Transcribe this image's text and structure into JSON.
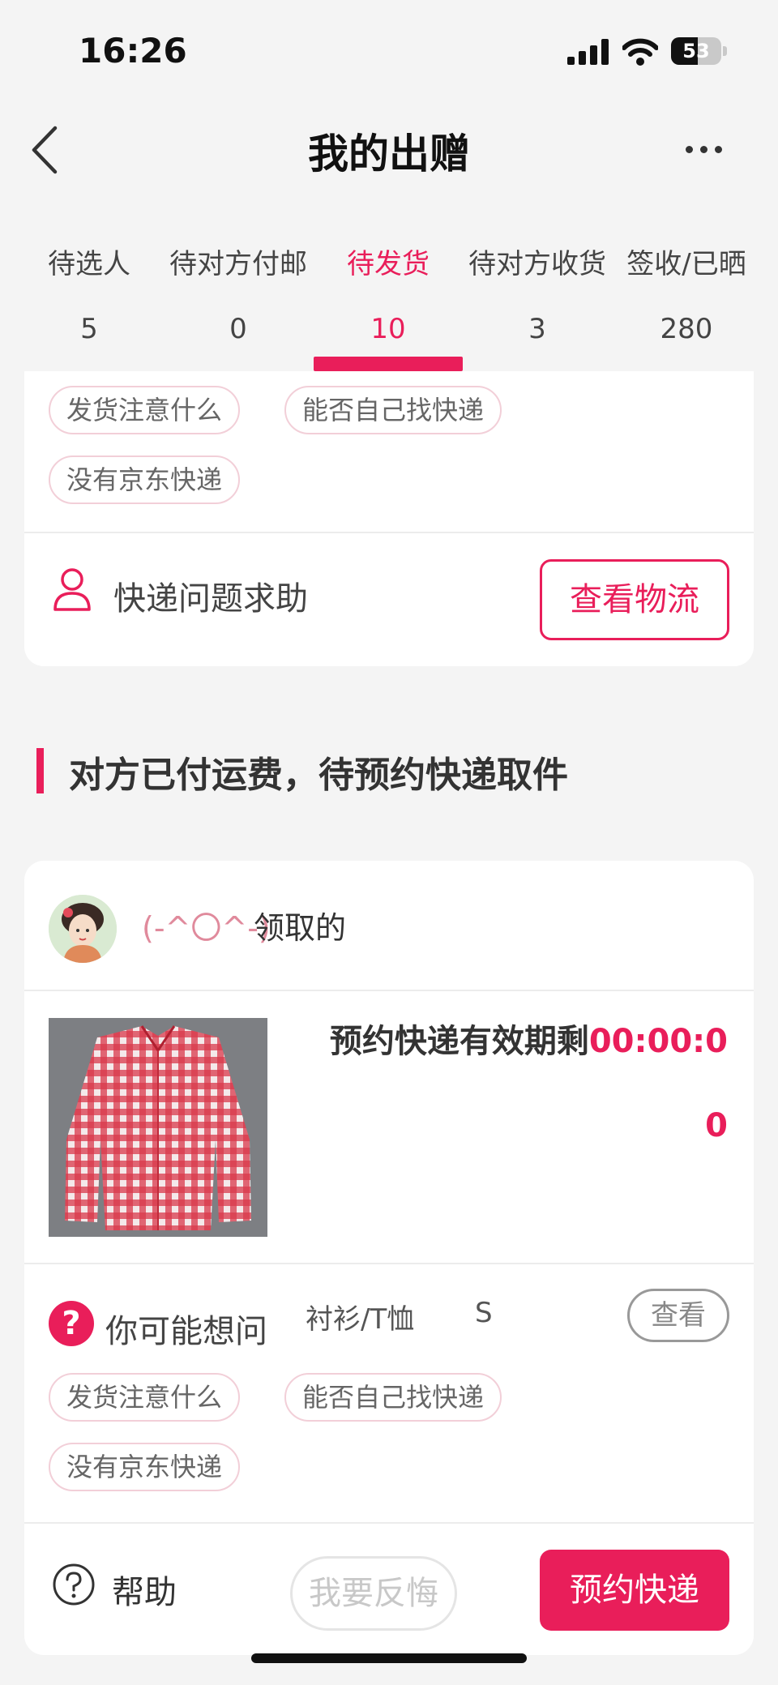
{
  "status_bar": {
    "time": "16:26",
    "battery": "53"
  },
  "header": {
    "title": "我的出赠"
  },
  "tabs": [
    {
      "label": "待选人",
      "count": "5"
    },
    {
      "label": "待对方付邮",
      "count": "0"
    },
    {
      "label": "待发货",
      "count": "10"
    },
    {
      "label": "待对方收货",
      "count": "3"
    },
    {
      "label": "签收/已晒",
      "count": "280"
    }
  ],
  "active_tab_index": 2,
  "top_card": {
    "chips": [
      "发货注意什么",
      "能否自己找快递",
      "没有京东快递"
    ],
    "help_label": "快递问题求助",
    "logistics_button": "查看物流"
  },
  "section": {
    "title": "对方已付运费，待预约快递取件"
  },
  "order": {
    "user_name": "(-^〇^-)",
    "user_action": "领取的",
    "countdown_label": "预约快递有效期剩",
    "countdown_value_part1": "00:00:0",
    "countdown_value_part2": "0",
    "question_label": "你可能想问",
    "category": "衬衫/T恤",
    "size": "S",
    "view_button": "查看",
    "chips": [
      "发货注意什么",
      "能否自己找快递",
      "没有京东快递"
    ],
    "help_label": "帮助",
    "regret_button": "我要反悔",
    "book_button": "预约快递"
  },
  "colors": {
    "accent": "#e91e5a",
    "chip_border": "#f2cfd8",
    "background": "#f4f4f4"
  },
  "icons": [
    "back-icon",
    "more-icon",
    "signal-icon",
    "wifi-icon",
    "battery-icon",
    "person-icon",
    "question-icon",
    "help-icon"
  ]
}
